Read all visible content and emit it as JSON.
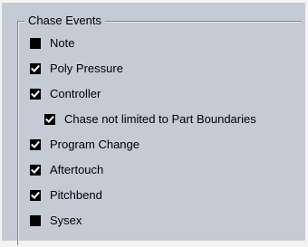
{
  "group": {
    "title": "Chase Events"
  },
  "options": [
    {
      "label": "Note",
      "checked": false
    },
    {
      "label": "Poly Pressure",
      "checked": true
    },
    {
      "label": "Controller",
      "checked": true
    },
    {
      "label": "Chase not limited to Part Boundaries",
      "checked": true,
      "indent": true
    },
    {
      "label": "Program Change",
      "checked": true
    },
    {
      "label": "Aftertouch",
      "checked": true
    },
    {
      "label": "Pitchbend",
      "checked": true
    },
    {
      "label": "Sysex",
      "checked": false
    }
  ]
}
